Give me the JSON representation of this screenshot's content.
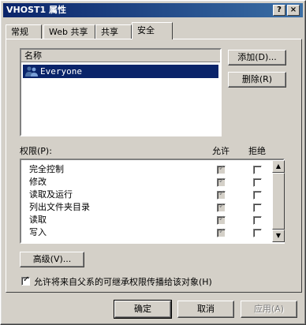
{
  "window": {
    "title": "VHOST1 属性",
    "help_label": "?",
    "close_label": "×"
  },
  "tabs": [
    {
      "label": "常规",
      "active": false
    },
    {
      "label": "Web 共享",
      "active": false
    },
    {
      "label": "共享",
      "active": false
    },
    {
      "label": "安全",
      "active": true
    }
  ],
  "users": {
    "header": "名称",
    "items": [
      {
        "name": "Everyone",
        "selected": true,
        "icon": "group-users-icon"
      }
    ]
  },
  "buttons": {
    "add": "添加(D)...",
    "remove": "删除(R)",
    "advanced": "高级(V)...",
    "ok": "确定",
    "cancel": "取消",
    "apply": "应用(A)"
  },
  "permissions": {
    "label": "权限(P):",
    "allow_header": "允许",
    "deny_header": "拒绝",
    "rows": [
      {
        "name": "完全控制",
        "allow": true,
        "deny": false
      },
      {
        "name": "修改",
        "allow": true,
        "deny": false
      },
      {
        "name": "读取及运行",
        "allow": true,
        "deny": false
      },
      {
        "name": "列出文件夹目录",
        "allow": true,
        "deny": false
      },
      {
        "name": "读取",
        "allow": true,
        "deny": false
      },
      {
        "name": "写入",
        "allow": true,
        "deny": false
      }
    ]
  },
  "inherit": {
    "label": "允许将来自父系的可继承权限传播给该对象(H)",
    "checked": true
  }
}
